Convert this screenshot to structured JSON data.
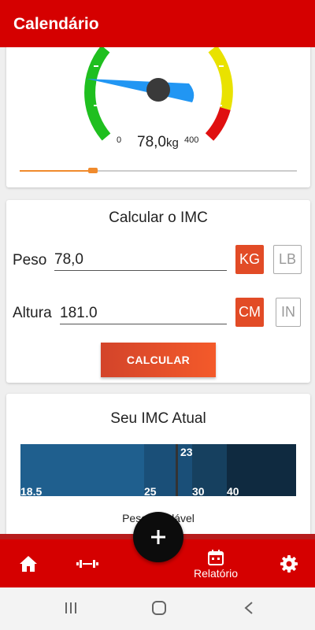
{
  "appbar": {
    "title": "Calendário"
  },
  "gauge": {
    "min": "0",
    "max": "400",
    "value": "78,0",
    "unit": "kg",
    "slider_fraction": 0.195
  },
  "calc": {
    "title": "Calcular o IMC",
    "weight_label": "Peso",
    "weight_value": "78,0",
    "weight_unit_active": "KG",
    "weight_unit_inactive": "LB",
    "height_label": "Altura",
    "height_value": "181.0",
    "height_unit_active": "CM",
    "height_unit_inactive": "IN",
    "button_label": "CALCULAR"
  },
  "bmi": {
    "title": "Seu IMC Atual",
    "current_value": "23",
    "ticks": [
      "18.5",
      "25",
      "30",
      "40"
    ],
    "caption": "Peso saudável"
  },
  "bottom_nav": {
    "items": [
      {
        "icon": "home-icon"
      },
      {
        "icon": "dumbbell-icon"
      },
      {
        "icon": "calendar-icon",
        "label": "Relatório"
      },
      {
        "icon": "gear-icon"
      }
    ],
    "fab_icon": "plus-icon"
  },
  "colors": {
    "primary": "#d50000",
    "accent": "#e24b26",
    "gauge_needle": "#2196f3",
    "bmi_segments": [
      "#1f5f8e",
      "#1a4f78",
      "#16405f",
      "#0f2a40"
    ]
  }
}
